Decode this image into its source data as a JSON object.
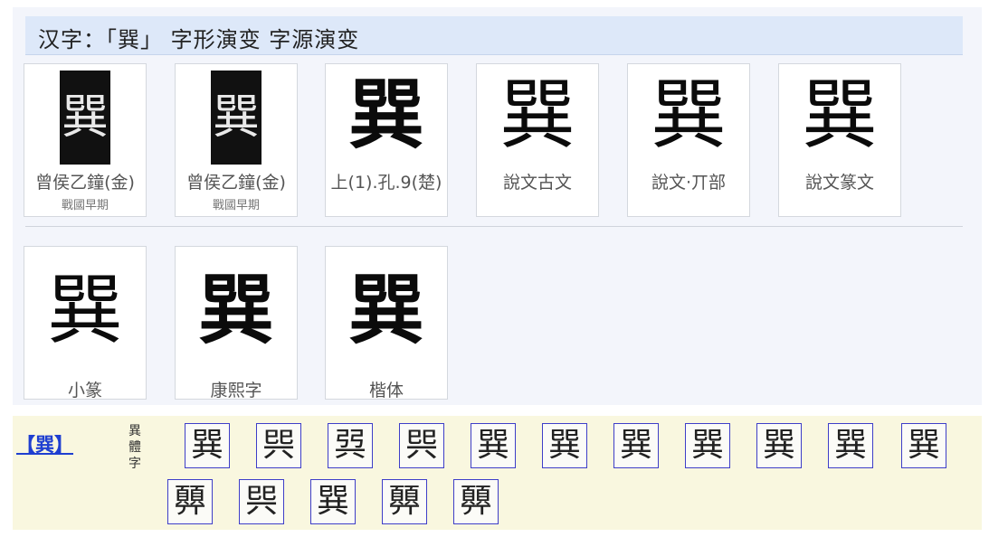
{
  "title": "汉字：「巽」 字形演变 字源演变",
  "evolution_row1": [
    {
      "glyph": "巽",
      "label": "曾侯乙鐘(金)",
      "sublabel": "戰國早期",
      "style": "rubbing"
    },
    {
      "glyph": "巽",
      "label": "曾侯乙鐘(金)",
      "sublabel": "戰國早期",
      "style": "rubbing"
    },
    {
      "glyph": "巽",
      "label": "上(1).孔.9(楚)",
      "sublabel": "",
      "style": "bold"
    },
    {
      "glyph": "巽",
      "label": "說文古文",
      "sublabel": "",
      "style": "plain"
    },
    {
      "glyph": "巽",
      "label": "說文·丌部",
      "sublabel": "",
      "style": "plain"
    },
    {
      "glyph": "巽",
      "label": "說文篆文",
      "sublabel": "",
      "style": "plain"
    }
  ],
  "evolution_row2": [
    {
      "glyph": "巽",
      "label": "小篆"
    },
    {
      "glyph": "巽",
      "label": "康熙字"
    },
    {
      "glyph": "巽",
      "label": "楷体"
    }
  ],
  "variants": {
    "link_text": "【巽】",
    "tag_text": "異體字",
    "row1": [
      "巽",
      "巺",
      "㢲",
      "巺",
      "巽",
      "巽",
      "巽",
      "巽",
      "巽",
      "巽",
      "巽"
    ],
    "row2": [
      "顨",
      "巺",
      "巽",
      "顨",
      "顨"
    ]
  }
}
